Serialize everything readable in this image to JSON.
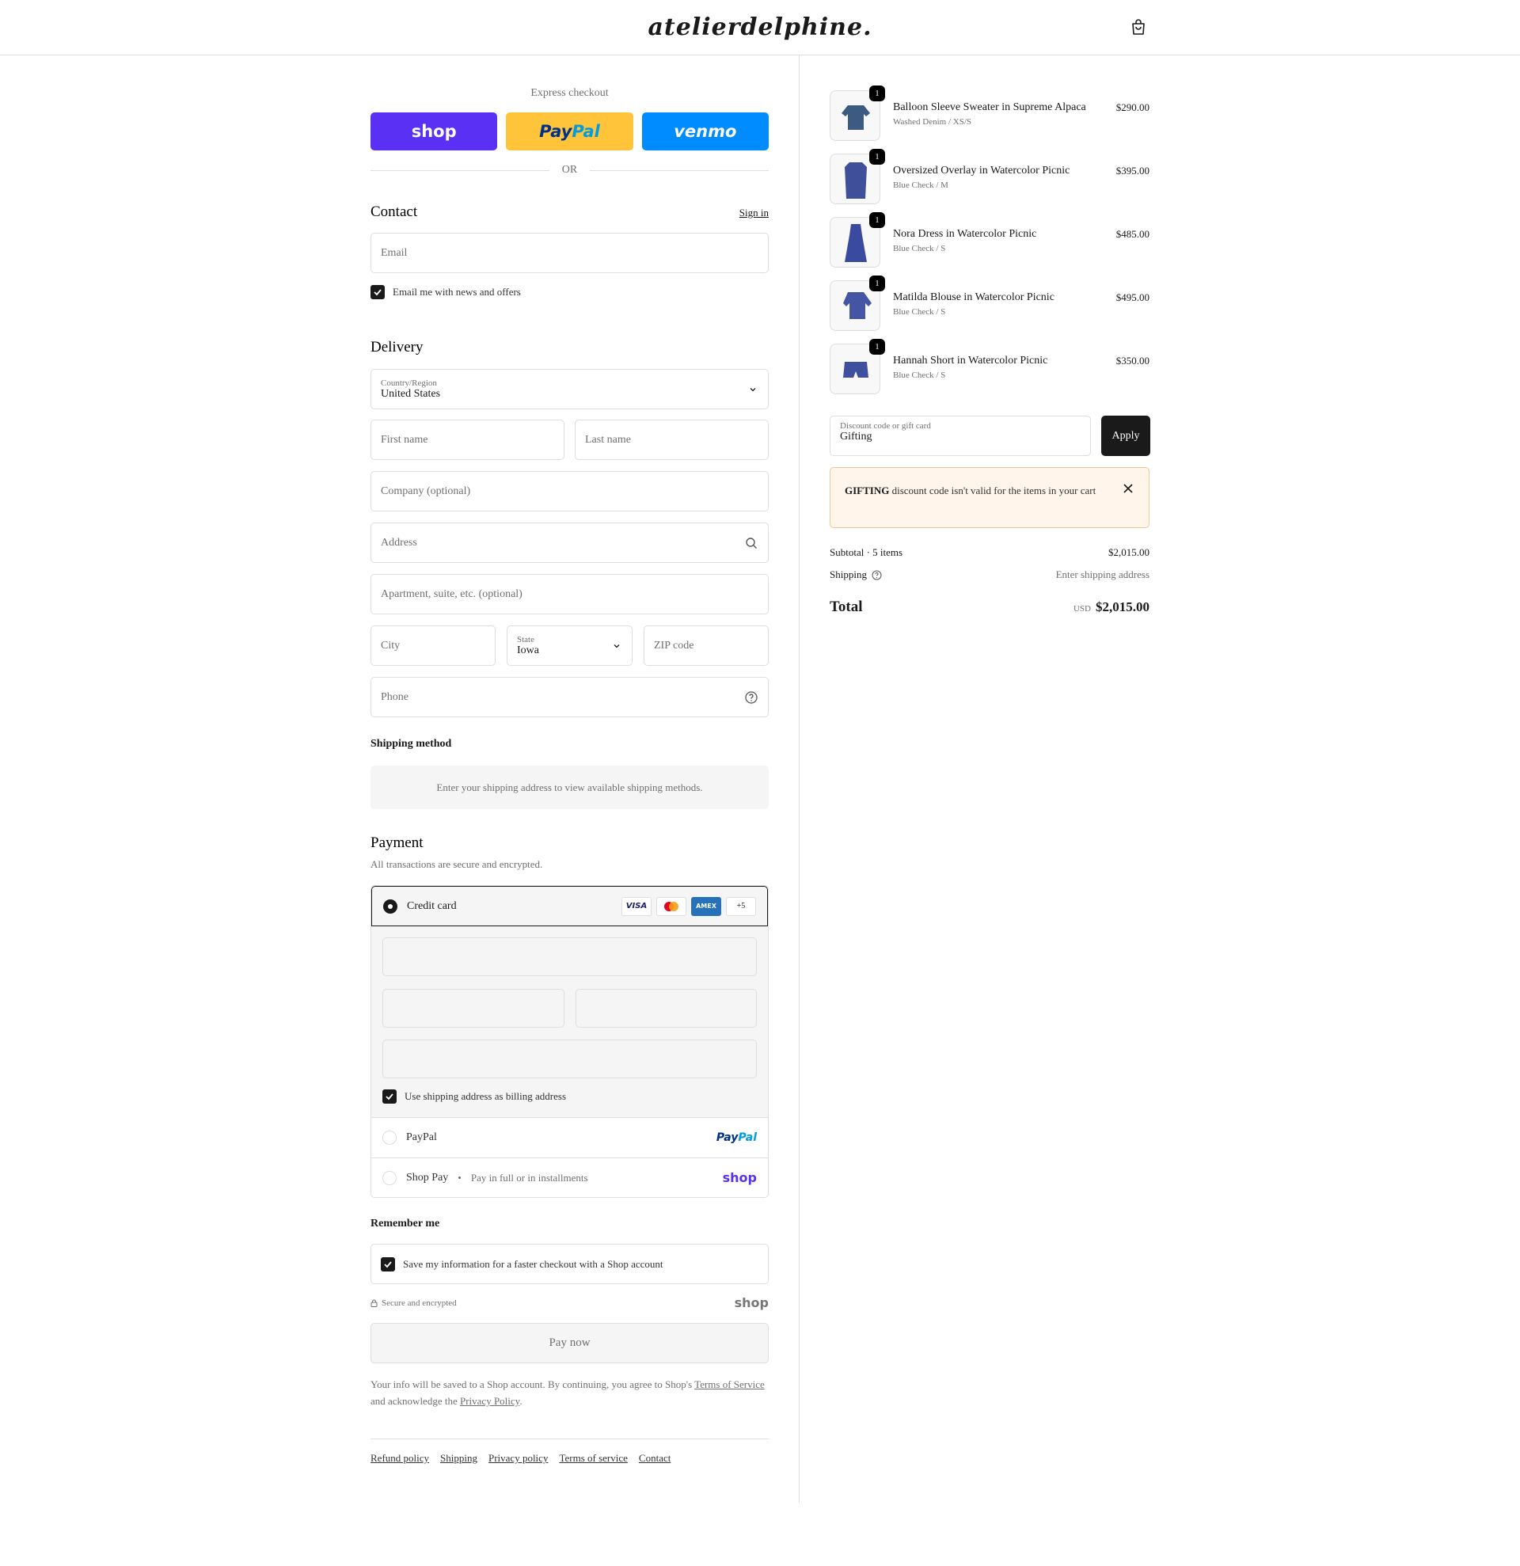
{
  "brand": {
    "logo": "atelierdelphine."
  },
  "express": {
    "label": "Express checkout",
    "shop": "shop",
    "paypal_a": "Pay",
    "paypal_b": "Pal",
    "venmo": "venmo",
    "or": "OR"
  },
  "contact": {
    "heading": "Contact",
    "sign_in": "Sign in",
    "email_placeholder": "Email",
    "news_label": "Email me with news and offers"
  },
  "delivery": {
    "heading": "Delivery",
    "country_label": "Country/Region",
    "country_value": "United States",
    "first_name": "First name",
    "last_name": "Last name",
    "company": "Company (optional)",
    "address": "Address",
    "apartment": "Apartment, suite, etc. (optional)",
    "city": "City",
    "state_label": "State",
    "state_value": "Iowa",
    "zip": "ZIP code",
    "phone": "Phone"
  },
  "shipping_method": {
    "heading": "Shipping method",
    "message": "Enter your shipping address to view available shipping methods."
  },
  "payment": {
    "heading": "Payment",
    "subtext": "All transactions are secure and encrypted.",
    "credit_card": "Credit card",
    "card_visa": "VISA",
    "card_amex": "AMEX",
    "more_cards": "+5",
    "billing_same": "Use shipping address as billing address",
    "paypal": "PayPal",
    "paypal_logo_a": "Pay",
    "paypal_logo_b": "Pal",
    "shop_pay": "Shop Pay",
    "shop_pay_sub": "Pay in full or in installments",
    "shop_logo": "shop"
  },
  "remember": {
    "heading": "Remember me",
    "save_label": "Save my information for a faster checkout with a Shop account",
    "secure": "Secure and encrypted",
    "shop_logo": "shop"
  },
  "pay_now": "Pay now",
  "legal": {
    "part1": "Your info will be saved to a Shop account. By continuing, you agree to Shop's ",
    "terms": "Terms of Service",
    "part2": " and acknowledge the ",
    "privacy": "Privacy Policy",
    "part3": "."
  },
  "footer": [
    "Refund policy",
    "Shipping",
    "Privacy policy",
    "Terms of service",
    "Contact"
  ],
  "cart": {
    "items": [
      {
        "name": "Balloon Sleeve Sweater in Supreme Alpaca",
        "variant": "Washed Denim / XS/S",
        "price": "$290.00",
        "qty": "1",
        "color": "#3d5a80"
      },
      {
        "name": "Oversized Overlay in Watercolor Picnic",
        "variant": "Blue Check / M",
        "price": "$395.00",
        "qty": "1",
        "color": "#3f4f9a"
      },
      {
        "name": "Nora Dress in Watercolor Picnic",
        "variant": "Blue Check / S",
        "price": "$485.00",
        "qty": "1",
        "color": "#3a4a9e"
      },
      {
        "name": "Matilda Blouse in Watercolor Picnic",
        "variant": "Blue Check / S",
        "price": "$495.00",
        "qty": "1",
        "color": "#4455a3"
      },
      {
        "name": "Hannah Short in Watercolor Picnic",
        "variant": "Blue Check / S",
        "price": "$350.00",
        "qty": "1",
        "color": "#3e4fa0"
      }
    ],
    "discount_label": "Discount code or gift card",
    "discount_value": "Gifting",
    "apply": "Apply",
    "alert_code": "GIFTING",
    "alert_text": " discount code isn't valid for the items in your cart",
    "subtotal_label": "Subtotal · 5 items",
    "subtotal_value": "$2,015.00",
    "shipping_label": "Shipping",
    "shipping_value": "Enter shipping address",
    "total_label": "Total",
    "currency": "USD",
    "total_value": "$2,015.00"
  }
}
